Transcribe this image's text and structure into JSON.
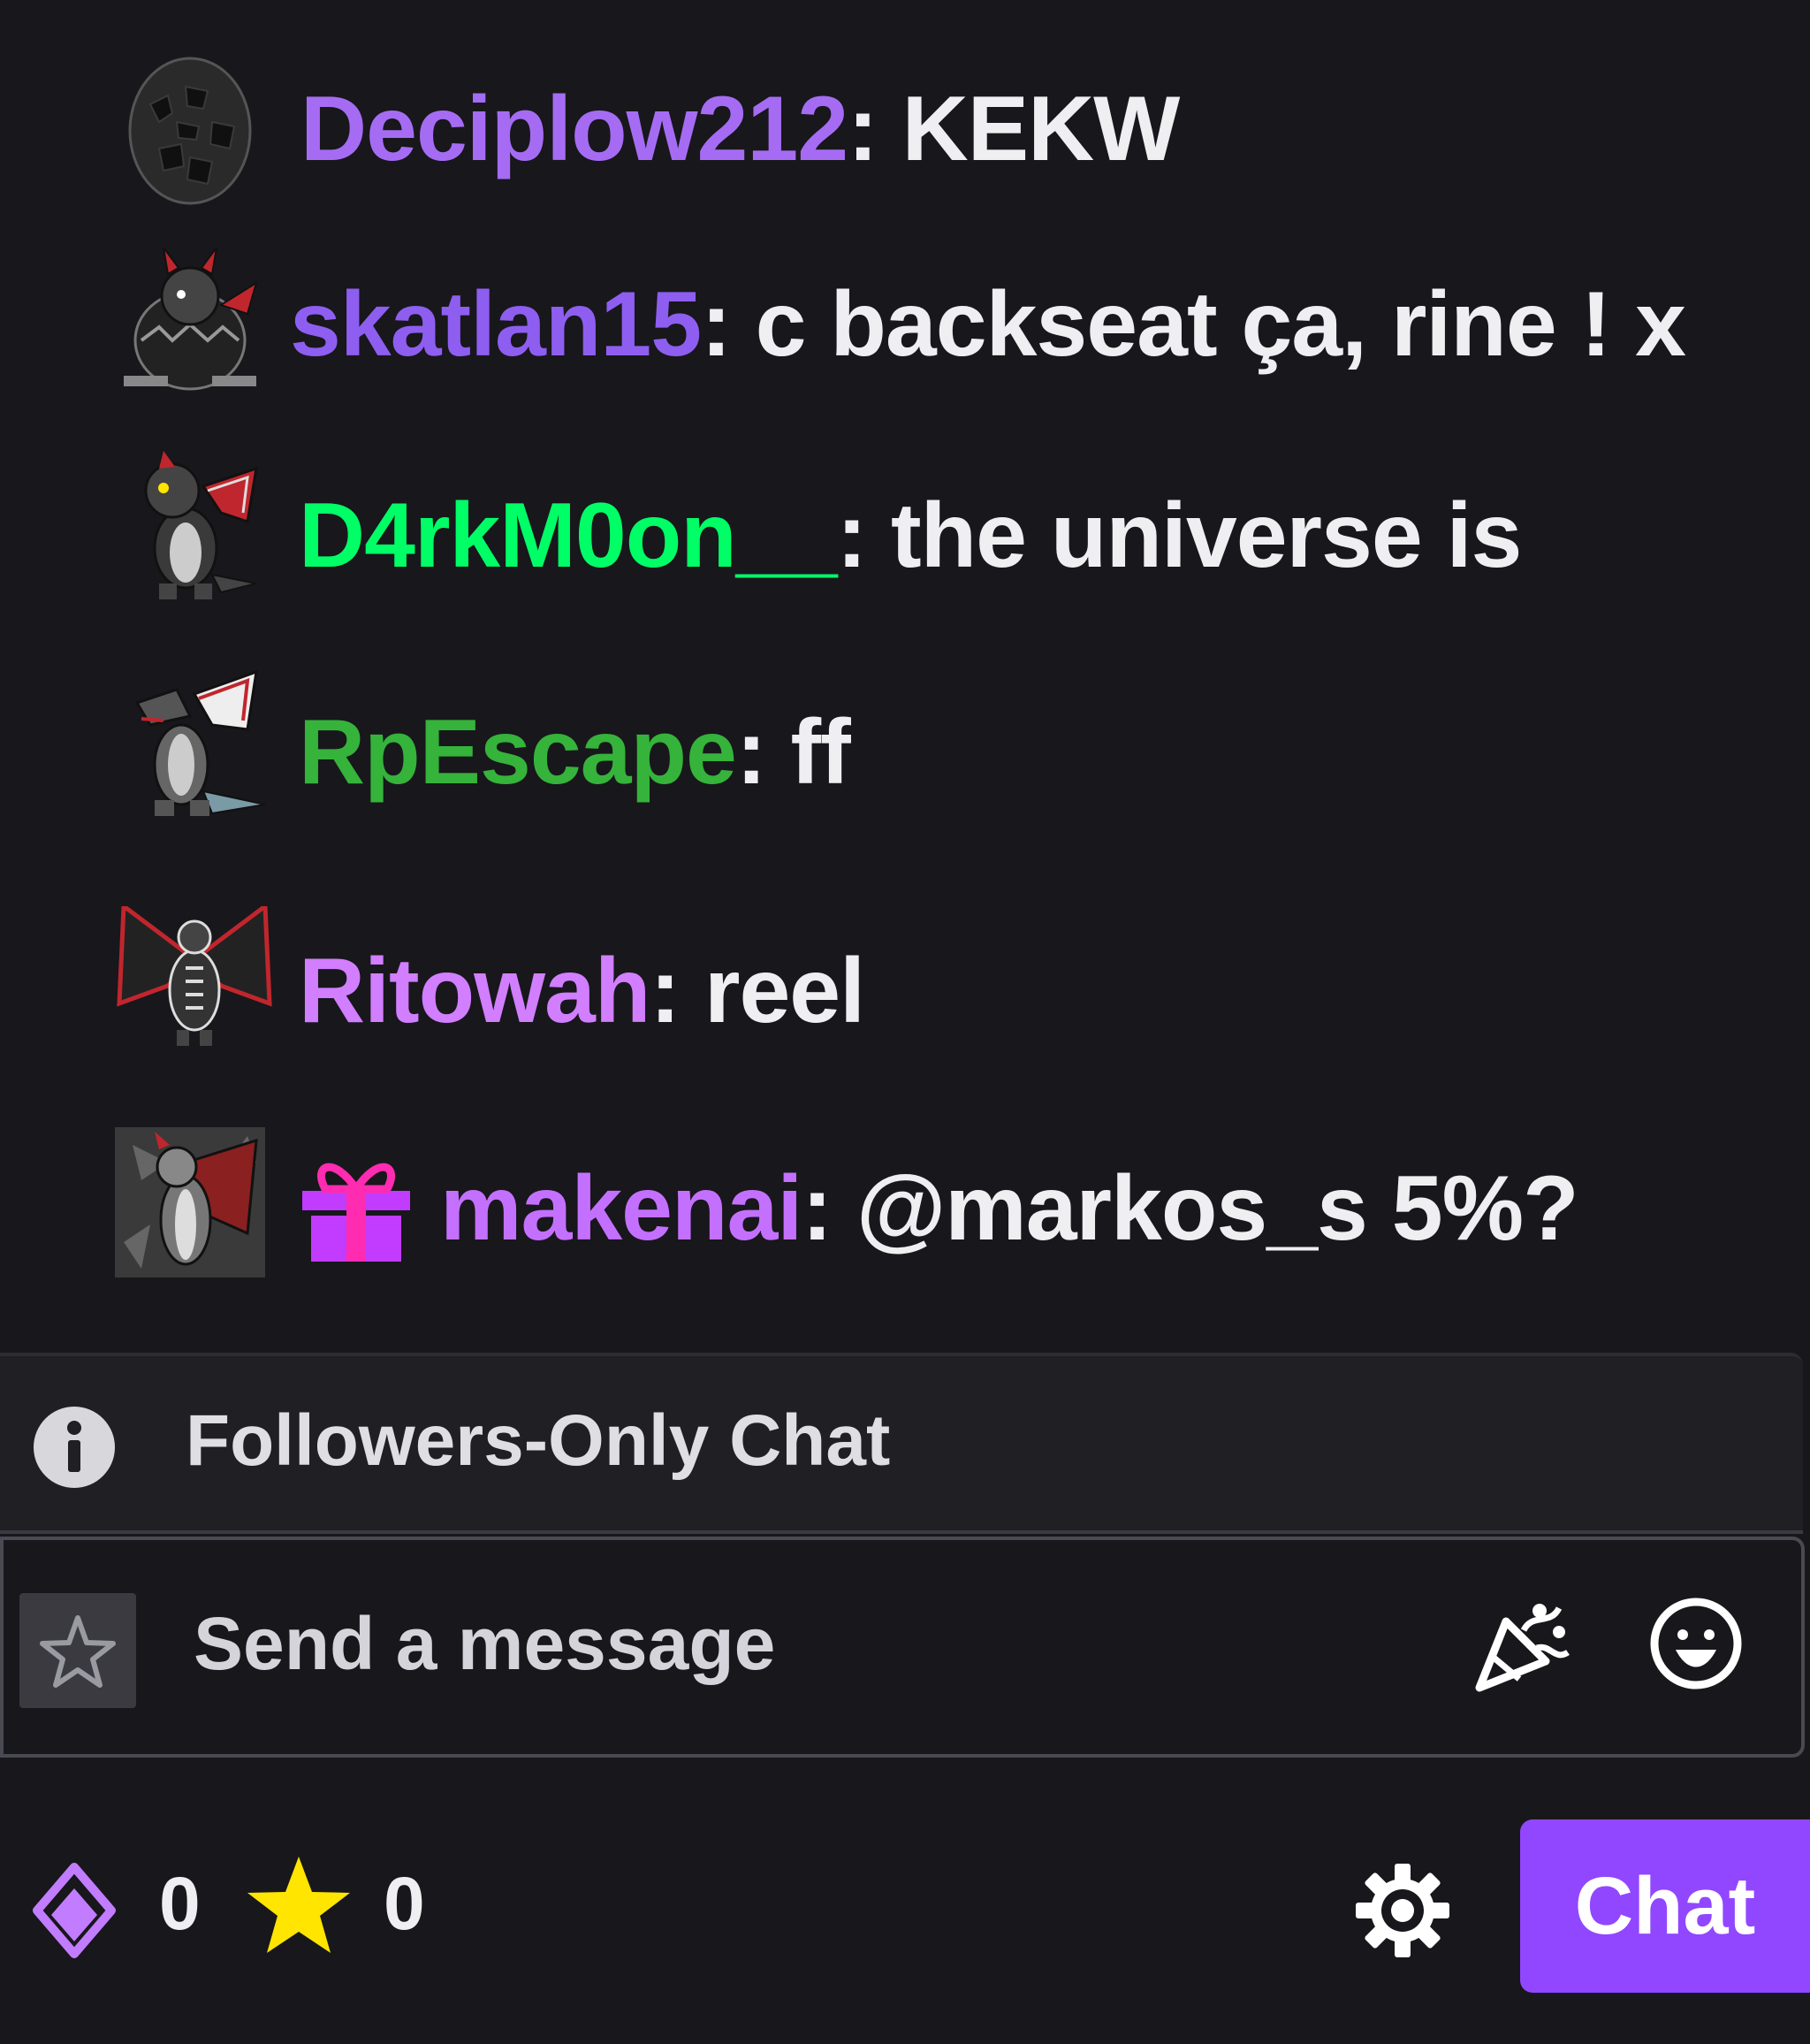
{
  "messages": [
    {
      "username": "Deciplow212",
      "separator": ":",
      "text": "KEKW",
      "color": "#a56cf3",
      "avatar": "black-egg-avatar"
    },
    {
      "username": "skatlan15",
      "separator": ":",
      "text": "c backseat ça, rine ! x",
      "color": "#8e5ef0",
      "avatar": "hatching-dragon-avatar"
    },
    {
      "username": "D4rkM0on__",
      "separator": ":",
      "text": "the universe is",
      "color": "#00ff66",
      "avatar": "baby-dragon-avatar"
    },
    {
      "username": "RpEscape",
      "separator": ":",
      "text": "ff",
      "color": "#35b33a",
      "avatar": "grey-dragon-avatar"
    },
    {
      "username": "Ritowah",
      "separator": ":",
      "text": "reel",
      "color": "#d17eff",
      "avatar": "winged-dragon-avatar"
    },
    {
      "username": "makenai",
      "separator": ":",
      "text": "@markos_s 5%?",
      "color": "#c470ff",
      "avatar": "dragon-portrait-avatar",
      "badge": "gift-icon"
    }
  ],
  "notice": {
    "label": "Followers-Only Chat",
    "icon": "info-icon"
  },
  "input": {
    "placeholder": "Send a message"
  },
  "footer": {
    "channel_points": "0",
    "stars": "0",
    "chat_button_label": "Chat"
  },
  "colors": {
    "background": "#18171c",
    "accent": "#9147ff",
    "star": "#ffe500",
    "gift": "#c13cff"
  }
}
